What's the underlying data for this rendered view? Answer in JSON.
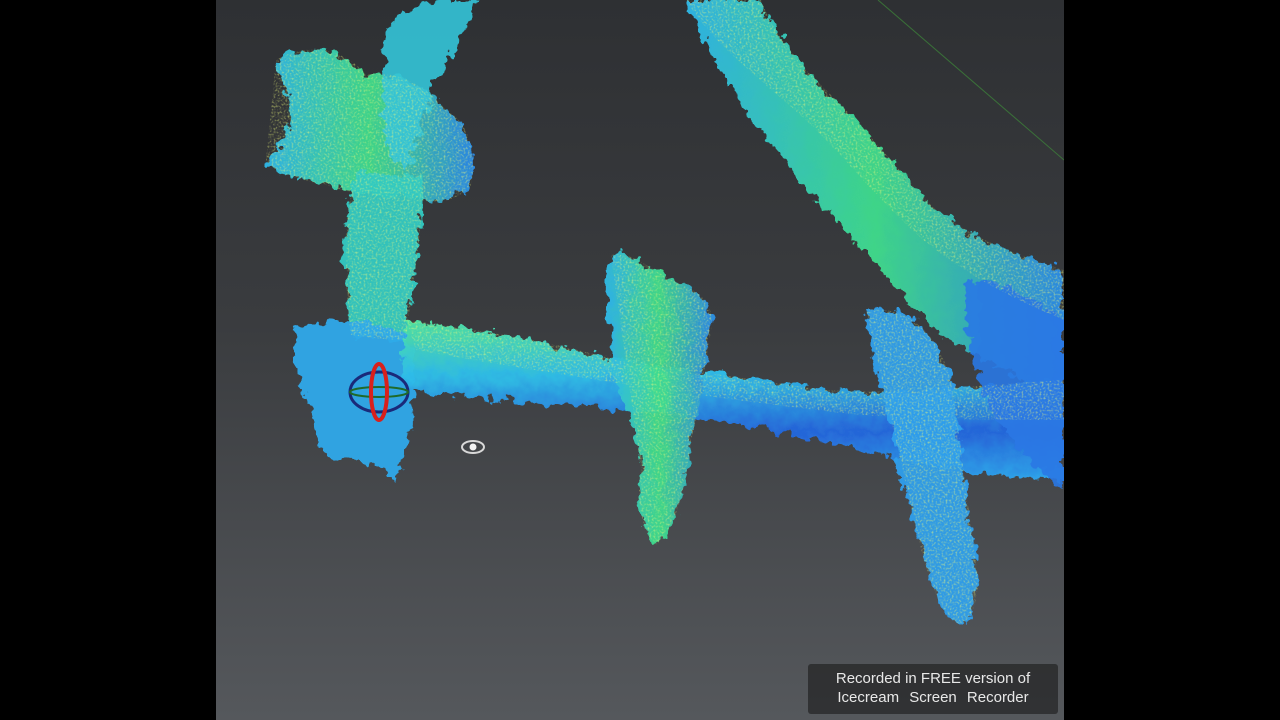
{
  "viewport": {
    "content": "point-cloud",
    "background_top": "#2e3033",
    "background_bottom": "#55585c",
    "palette": [
      "#1e4fd6",
      "#2e86f0",
      "#2fd0e0",
      "#3fe07a",
      "#c8f03c",
      "#f0c020"
    ],
    "gizmo_icon": "rotation-gizmo-icon",
    "cursor_icon": "eye-cursor-icon"
  },
  "watermark": {
    "line1": "Recorded in FREE version of",
    "line2": "Icecream Screen Recorder"
  }
}
